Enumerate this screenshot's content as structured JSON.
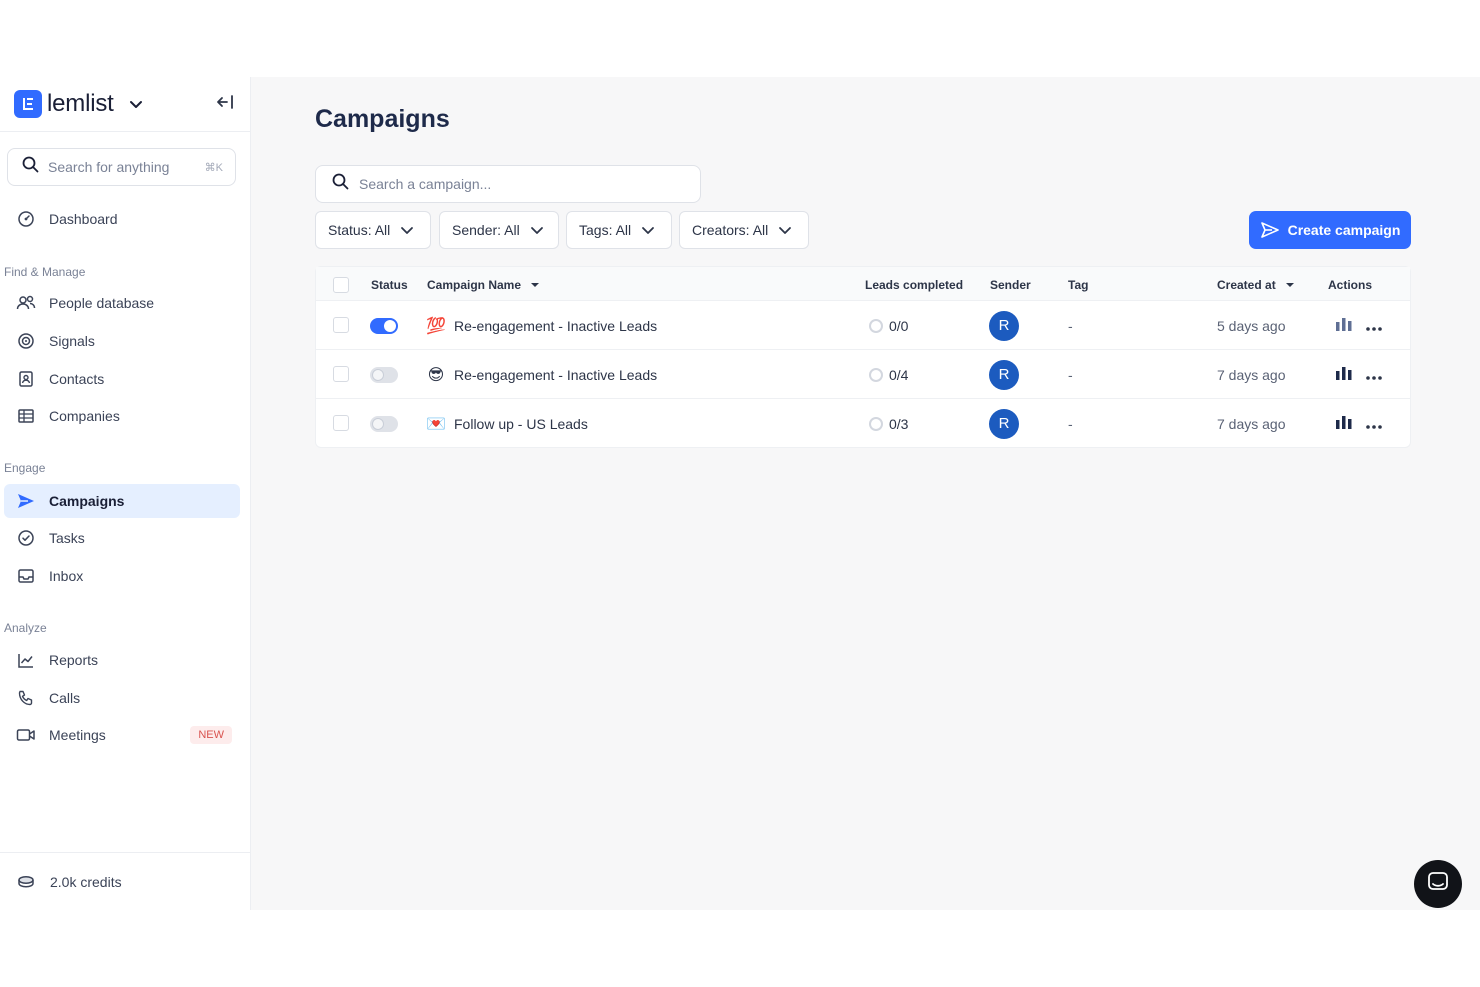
{
  "app": {
    "brand": "lemlist"
  },
  "sidebar": {
    "search_placeholder": "Search for anything",
    "search_shortcut": "⌘K",
    "dashboard": "Dashboard",
    "sections": {
      "find_manage": "Find & Manage",
      "engage": "Engage",
      "analyze": "Analyze"
    },
    "items": {
      "people_database": "People database",
      "signals": "Signals",
      "contacts": "Contacts",
      "companies": "Companies",
      "campaigns": "Campaigns",
      "tasks": "Tasks",
      "inbox": "Inbox",
      "reports": "Reports",
      "calls": "Calls",
      "meetings": "Meetings"
    },
    "meetings_badge": "NEW",
    "credits": "2.0k credits"
  },
  "main": {
    "title": "Campaigns",
    "search_placeholder": "Search a campaign...",
    "filters": {
      "status": "Status: All",
      "sender": "Sender: All",
      "tags": "Tags: All",
      "creators": "Creators: All"
    },
    "create_button": "Create campaign",
    "table": {
      "headers": {
        "status": "Status",
        "name": "Campaign Name",
        "leads": "Leads completed",
        "sender": "Sender",
        "tag": "Tag",
        "created": "Created at",
        "actions": "Actions"
      },
      "rows": [
        {
          "active": true,
          "emoji": "💯",
          "name": "Re-engagement - Inactive Leads",
          "leads": "0/0",
          "sender": "R",
          "tag": "-",
          "created": "5 days ago"
        },
        {
          "active": false,
          "emoji": "😎",
          "name": "Re-engagement - Inactive Leads",
          "leads": "0/4",
          "sender": "R",
          "tag": "-",
          "created": "7 days ago"
        },
        {
          "active": false,
          "emoji": "💌",
          "name": "Follow up - US Leads",
          "leads": "0/3",
          "sender": "R",
          "tag": "-",
          "created": "7 days ago"
        }
      ]
    }
  },
  "colors": {
    "accent": "#316bff",
    "avatar": "#1c5bbf",
    "active_nav_bg": "#e5efff"
  }
}
